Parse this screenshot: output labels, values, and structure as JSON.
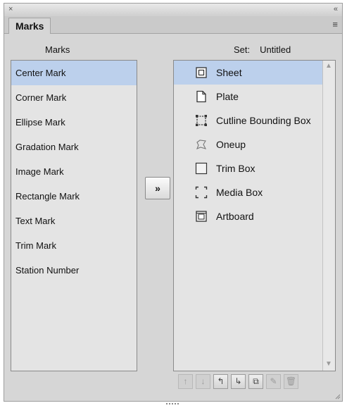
{
  "window": {
    "close_glyph": "×",
    "collapse_glyph": "«"
  },
  "tab": {
    "label": "Marks"
  },
  "panel_menu_glyph": "≡",
  "headers": {
    "marks": "Marks",
    "set_label": "Set:",
    "set_value": "Untitled"
  },
  "marks_list": [
    {
      "label": "Center Mark",
      "selected": true
    },
    {
      "label": "Corner Mark"
    },
    {
      "label": "Ellipse Mark"
    },
    {
      "label": "Gradation Mark"
    },
    {
      "label": "Image Mark"
    },
    {
      "label": "Rectangle Mark"
    },
    {
      "label": "Text Mark"
    },
    {
      "label": "Trim Mark"
    },
    {
      "label": "Station Number"
    }
  ],
  "add_button_label": "»",
  "set_list": [
    {
      "label": "Sheet",
      "icon": "sheet-icon",
      "selected": true
    },
    {
      "label": "Plate",
      "icon": "plate-icon"
    },
    {
      "label": "Cutline Bounding Box",
      "icon": "cutline-bounding-box-icon"
    },
    {
      "label": "Oneup",
      "icon": "oneup-icon"
    },
    {
      "label": "Trim Box",
      "icon": "trim-box-icon"
    },
    {
      "label": "Media Box",
      "icon": "media-box-icon"
    },
    {
      "label": "Artboard",
      "icon": "artboard-icon"
    }
  ],
  "scroll": {
    "up_glyph": "▲",
    "down_glyph": "▼"
  },
  "toolbar": [
    {
      "name": "move-up-button",
      "glyph": "↑",
      "icon": "arrow-up-icon"
    },
    {
      "name": "move-down-button",
      "glyph": "↓",
      "icon": "arrow-down-icon"
    },
    {
      "name": "move-out-button",
      "glyph": "↰",
      "icon": "outdent-icon"
    },
    {
      "name": "move-in-button",
      "glyph": "↳",
      "icon": "indent-icon"
    },
    {
      "name": "duplicate-button",
      "glyph": "⧉",
      "icon": "duplicate-icon"
    },
    {
      "name": "edit-button",
      "glyph": "✎",
      "icon": "edit-icon"
    },
    {
      "name": "delete-button",
      "glyph": "🗑",
      "icon": "trash-icon"
    }
  ],
  "colors": {
    "panel": "#d6d6d6",
    "list_bg": "#e4e4e4",
    "selection": "#bcd0ec",
    "border": "#8a8a8a"
  }
}
